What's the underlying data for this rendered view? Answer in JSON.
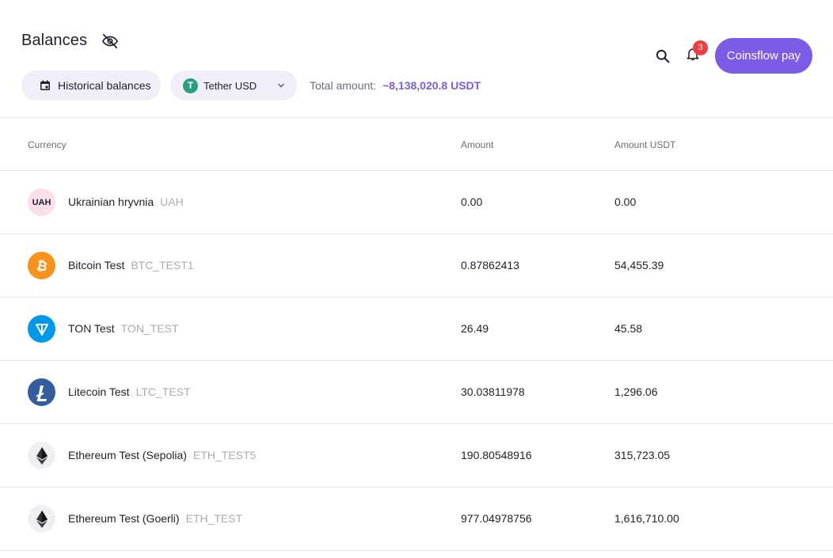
{
  "header": {
    "title": "Balances",
    "historical_label": "Historical balances",
    "currency_label": "Tether USD",
    "tether_glyph": "T",
    "total_label": "Total amount:",
    "total_value": "~8,138,020.8 USDT",
    "notifications_count": "3",
    "cta_label": "Coinsflow pay"
  },
  "table": {
    "columns": [
      "Currency",
      "Amount",
      "Amount USDT"
    ],
    "rows": [
      {
        "name": "Ukrainian hryvnia",
        "code": "UAH",
        "amount": "0.00",
        "amount_usdt": "0.00",
        "logo_text": "UAH",
        "icon": "uah-icon"
      },
      {
        "name": "Bitcoin Test",
        "code": "BTC_TEST1",
        "amount": "0.87862413",
        "amount_usdt": "54,455.39",
        "icon": "bitcoin-icon"
      },
      {
        "name": "TON Test",
        "code": "TON_TEST",
        "amount": "26.49",
        "amount_usdt": "45.58",
        "icon": "ton-icon"
      },
      {
        "name": "Litecoin Test",
        "code": "LTC_TEST",
        "amount": "30.03811978",
        "amount_usdt": "1,296.06",
        "icon": "litecoin-icon"
      },
      {
        "name": "Ethereum Test (Sepolia)",
        "code": "ETH_TEST5",
        "amount": "190.80548916",
        "amount_usdt": "315,723.05",
        "icon": "ethereum-icon"
      },
      {
        "name": "Ethereum Test (Goerli)",
        "code": "ETH_TEST",
        "amount": "977.04978756",
        "amount_usdt": "1,616,710.00",
        "icon": "ethereum-icon"
      }
    ]
  },
  "colors": {
    "accent": "#7a5ce6",
    "total_value": "#7c5ce0",
    "badge": "#f03e3e",
    "tether": "#26a17b",
    "bitcoin": "#f7931a",
    "ton": "#0098ea",
    "litecoin": "#345d9d"
  }
}
